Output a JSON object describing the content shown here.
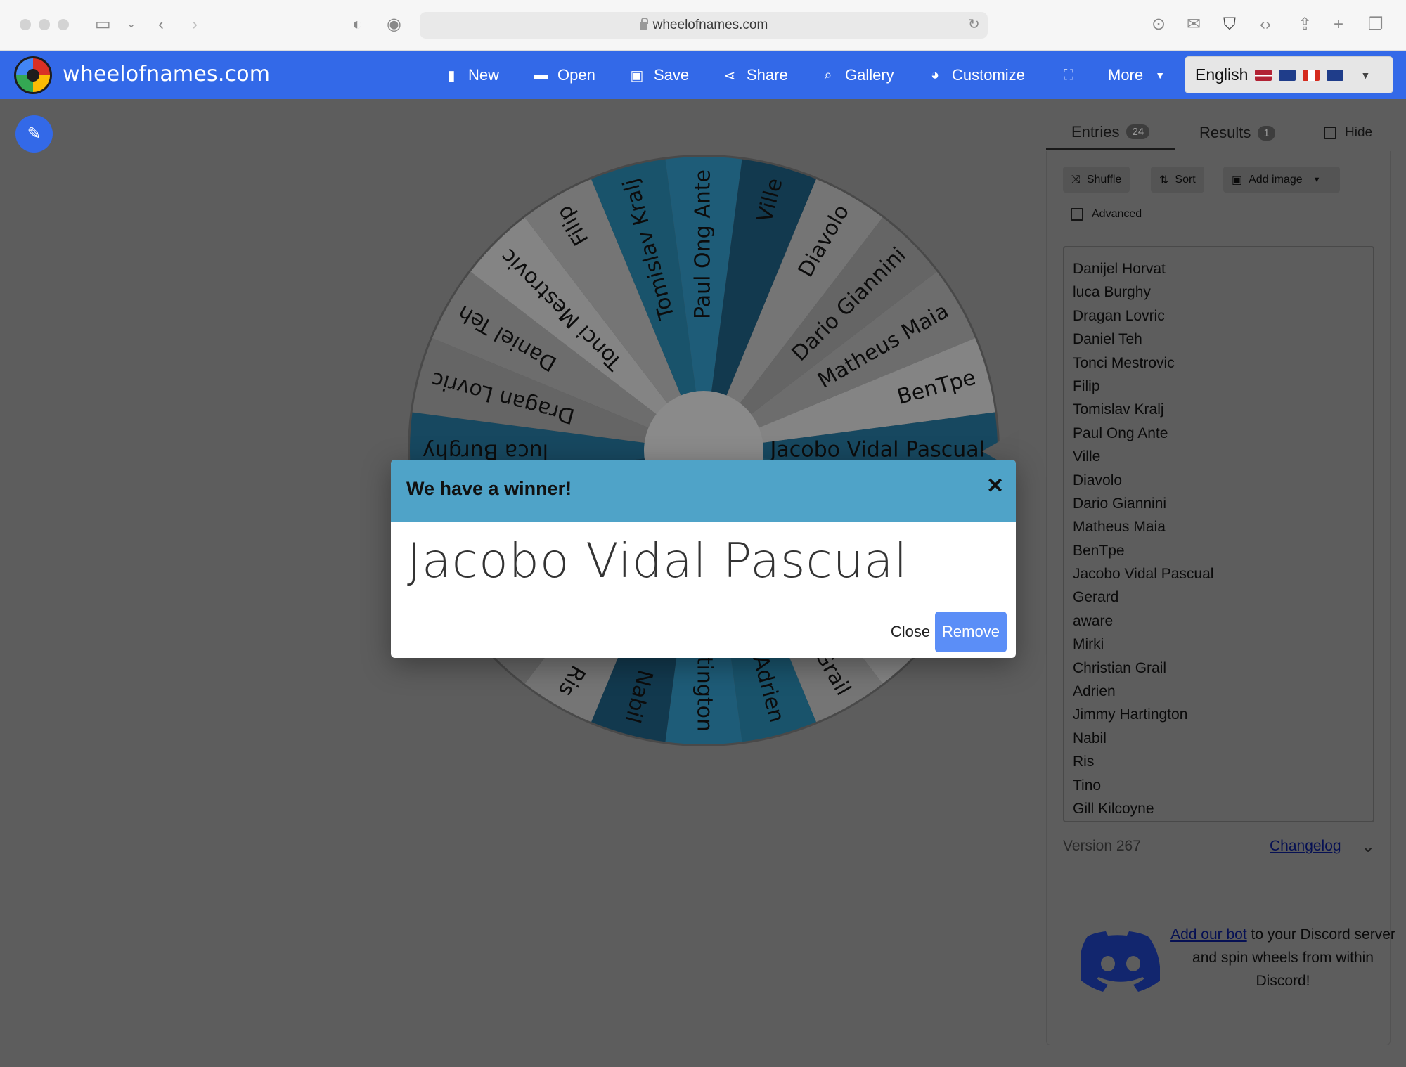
{
  "browser": {
    "url": "wheelofnames.com"
  },
  "app": {
    "brand": "wheelofnames.com"
  },
  "nav": {
    "new": "New",
    "open": "Open",
    "save": "Save",
    "share": "Share",
    "gallery": "Gallery",
    "customize": "Customize",
    "more": "More",
    "language": "English"
  },
  "tabs": {
    "entries": "Entries",
    "entries_count": "24",
    "results": "Results",
    "results_count": "1",
    "hide": "Hide"
  },
  "tools": {
    "shuffle": "Shuffle",
    "sort": "Sort",
    "add_image": "Add image",
    "advanced": "Advanced"
  },
  "entries": [
    "Danijel Horvat",
    "luca Burghy",
    "Dragan Lovric",
    "Daniel Teh",
    "Tonci Mestrovic",
    "Filip",
    "Tomislav Kralj",
    "Paul Ong Ante",
    "Ville",
    "Diavolo",
    "Dario Giannini",
    "Matheus Maia",
    "BenTpe",
    "Jacobo Vidal Pascual",
    "Gerard",
    "aware",
    "Mirki",
    "Christian Grail",
    "Adrien",
    "Jimmy Hartington",
    "Nabil",
    "Ris",
    "Tino",
    "Gill Kilcoyne"
  ],
  "footer": {
    "version": "Version 267",
    "changelog": "Changelog"
  },
  "discord": {
    "link": "Add our bot",
    "text": " to your Discord server and spin wheels from within Discord!"
  },
  "dialog": {
    "title": "We have a winner!",
    "winner": "Jacobo Vidal Pascual",
    "close": "Close",
    "remove": "Remove"
  },
  "wheel": {
    "colors": [
      "#1e5f83",
      "#2779a0",
      "#2a8bb3",
      "#3399c8"
    ],
    "gray_colors": [
      "#dcdcdc",
      "#c4c4c4",
      "#a8a8a8",
      "#b6b6b6"
    ]
  }
}
